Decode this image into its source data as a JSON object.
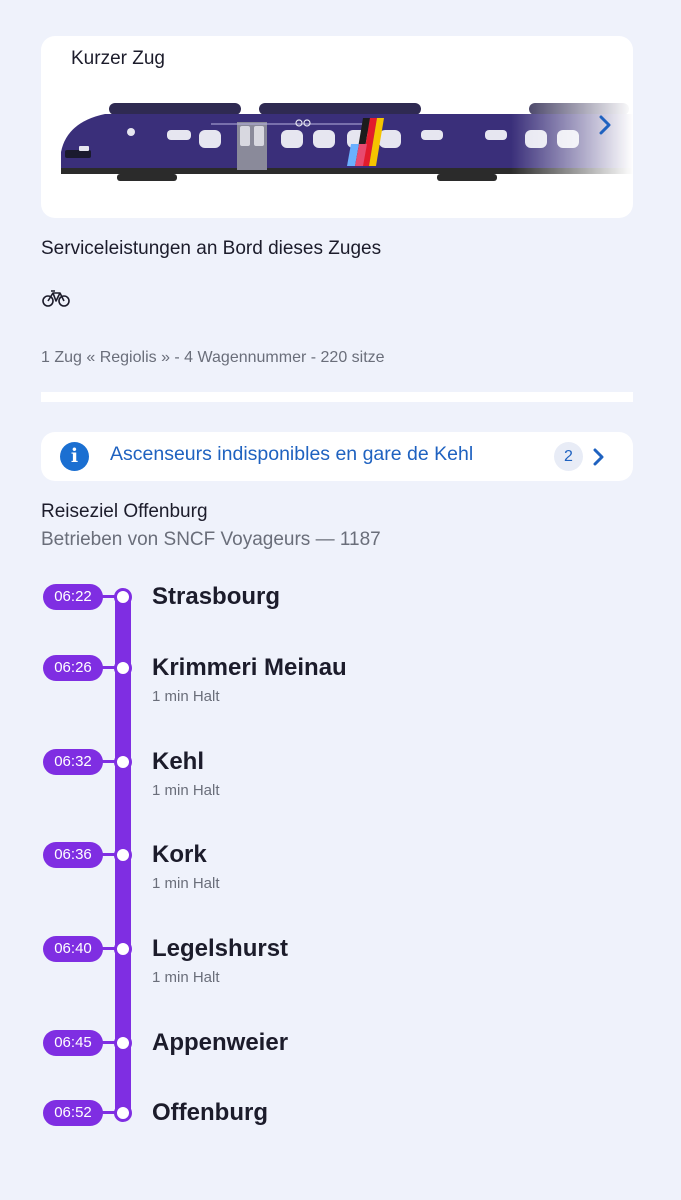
{
  "train_card": {
    "title": "Kurzer Zug",
    "train_colors": {
      "body": "#3a2f7a",
      "roof": "#2f2a52",
      "flag": [
        "#1c1c1c",
        "#e21b2c",
        "#f5c400"
      ],
      "stripe": [
        "#6ab0ff",
        "#e84a6f"
      ]
    }
  },
  "services": {
    "title": "Serviceleistungen an Bord dieses Zuges",
    "icons": [
      "bike-icon"
    ],
    "train_info": "1 Zug « Regiolis » - 4 Wagennummer - 220 sitze"
  },
  "alert": {
    "icon": "info-icon",
    "icon_glyph": "i",
    "text": "Ascenseurs indisponibles en gare de Kehl",
    "count": "2"
  },
  "journey": {
    "destination": "Reiseziel Offenburg",
    "operator": "Betrieben von SNCF Voyageurs — 1187",
    "accent_color": "#7f2ee2",
    "stops": [
      {
        "time": "06:22",
        "name": "Strasbourg",
        "halt": ""
      },
      {
        "time": "06:26",
        "name": "Krimmeri Meinau",
        "halt": "1 min Halt"
      },
      {
        "time": "06:32",
        "name": "Kehl",
        "halt": "1 min Halt"
      },
      {
        "time": "06:36",
        "name": "Kork",
        "halt": "1 min Halt"
      },
      {
        "time": "06:40",
        "name": "Legelshurst",
        "halt": "1 min Halt"
      },
      {
        "time": "06:45",
        "name": "Appenweier",
        "halt": ""
      },
      {
        "time": "06:52",
        "name": "Offenburg",
        "halt": ""
      }
    ]
  }
}
